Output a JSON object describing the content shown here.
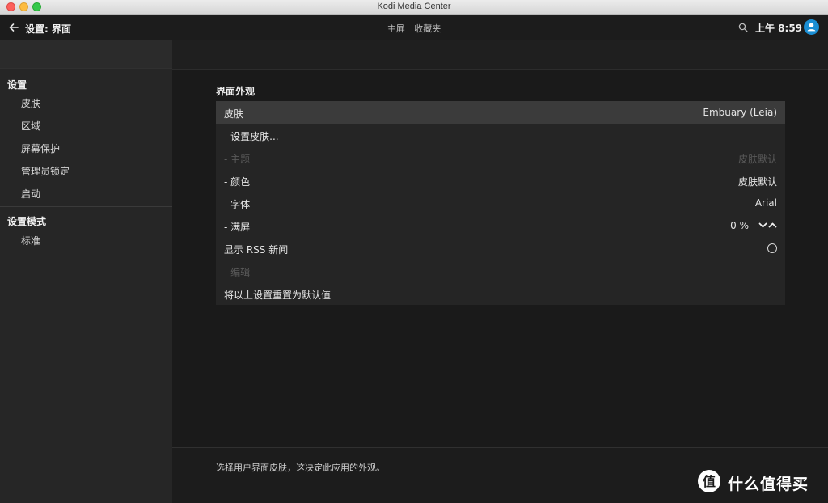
{
  "window": {
    "title": "Kodi Media Center"
  },
  "topbar": {
    "breadcrumb": "设置: 界面",
    "nav": [
      "主屏",
      "收藏夹"
    ],
    "clock": "上午 8:59",
    "icons": {
      "back": "back-arrow-icon",
      "search": "search-icon",
      "profile": "user-avatar-icon"
    }
  },
  "sidebar": {
    "heading": "设置",
    "items": [
      {
        "label": "皮肤"
      },
      {
        "label": "区域"
      },
      {
        "label": "屏幕保护"
      },
      {
        "label": "管理员锁定"
      },
      {
        "label": "启动"
      }
    ],
    "mode_heading": "设置模式",
    "mode_items": [
      {
        "label": "标准"
      }
    ]
  },
  "main": {
    "section_title": "界面外观",
    "rows": [
      {
        "label": "皮肤",
        "value": "Embuary (Leia)",
        "selected": true,
        "disabled": false
      },
      {
        "label": "- 设置皮肤...",
        "value": "",
        "selected": false,
        "disabled": false
      },
      {
        "label": "- 主题",
        "value": "皮肤默认",
        "selected": false,
        "disabled": true
      },
      {
        "label": "- 颜色",
        "value": "皮肤默认",
        "selected": false,
        "disabled": false
      },
      {
        "label": "- 字体",
        "value": "Arial",
        "selected": false,
        "disabled": false
      },
      {
        "label": "- 满屏",
        "value": "0 %",
        "selected": false,
        "disabled": false,
        "control": "spinner"
      },
      {
        "label": "显示 RSS 新闻",
        "value": "",
        "selected": false,
        "disabled": false,
        "control": "radio",
        "checked": false
      },
      {
        "label": "- 编辑",
        "value": "",
        "selected": false,
        "disabled": true
      },
      {
        "label": "将以上设置重置为默认值",
        "value": "",
        "selected": false,
        "disabled": false
      }
    ]
  },
  "footer": {
    "description": "选择用户界面皮肤，这决定此应用的外观。"
  },
  "watermark": {
    "text": "什么值得买",
    "logo": "smzdm-logo"
  },
  "colors": {
    "accent": "#1a8ed4",
    "selected_row": "#3b3b3b",
    "panel": "#252525",
    "sidebar": "#262626",
    "background": "#1a1a1a"
  }
}
